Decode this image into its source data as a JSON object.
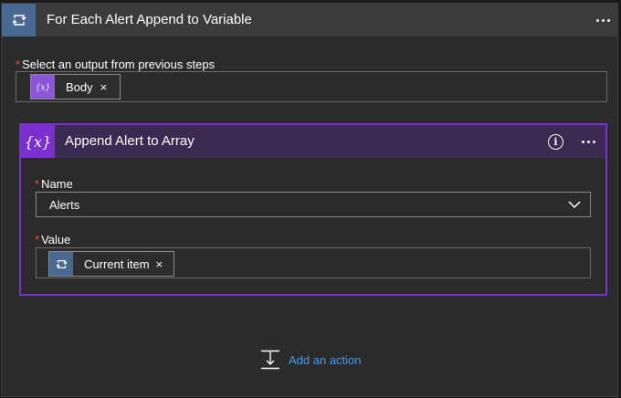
{
  "loop_block": {
    "title": "For Each Alert Append to Variable",
    "icon": "loop-icon",
    "output_label": "Select an output from previous steps",
    "output_token": {
      "icon": "expression-icon",
      "label": "Body",
      "remove": "×"
    }
  },
  "inner_action": {
    "title": "Append Alert to Array",
    "icon_text": "{x}",
    "info_icon_text": "i",
    "name_label": "Name",
    "name_value": "Alerts",
    "value_label": "Value",
    "value_token": {
      "icon": "loop-icon",
      "label": "Current item",
      "remove": "×"
    }
  },
  "add_action": {
    "label": "Add an action",
    "icon": "insert-step-icon"
  },
  "required_marker": "*",
  "colors": {
    "loop_accent": "#486991",
    "variable_accent": "#7b2fd1",
    "link": "#3b9cf5",
    "required": "#e74c3c"
  }
}
